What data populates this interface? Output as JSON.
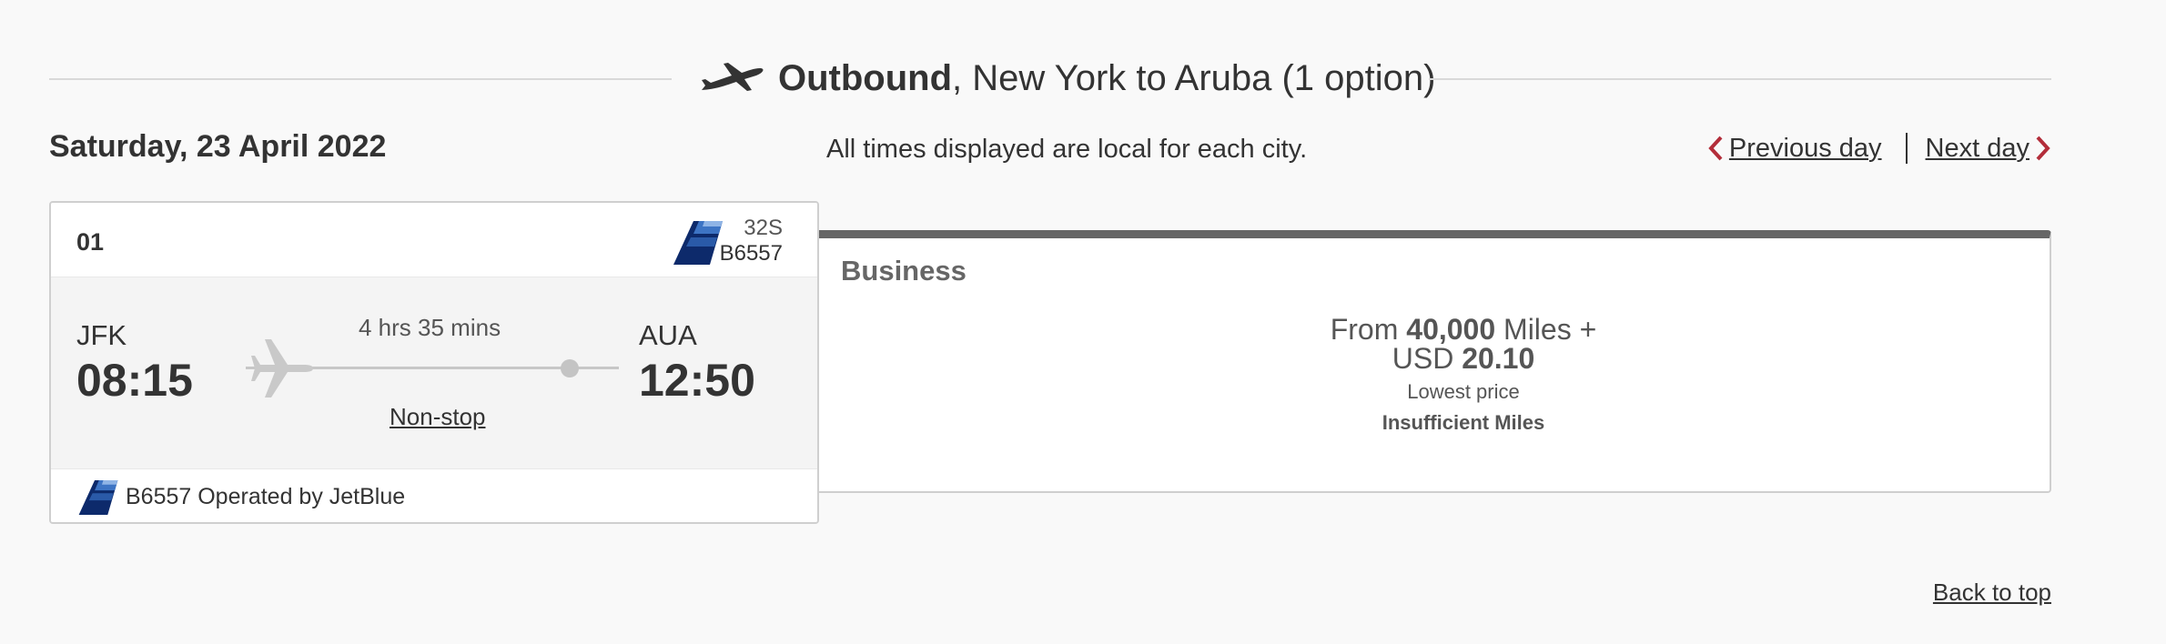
{
  "header": {
    "direction": "Outbound",
    "route": ", New York to Aruba (1 option)"
  },
  "date": "Saturday, 23 April 2022",
  "time_note": "All times displayed are local for each city.",
  "day_nav": {
    "previous": "Previous day",
    "next": "Next day"
  },
  "flight": {
    "option_number": "01",
    "aircraft_type": "32S",
    "flight_number": "B6557",
    "departure": {
      "code": "JFK",
      "time": "08:15"
    },
    "arrival": {
      "code": "AUA",
      "time": "12:50"
    },
    "duration": "4 hrs 35 mins",
    "stops": "Non-stop",
    "operated_by": "B6557 Operated by JetBlue"
  },
  "fare": {
    "cabin": "Business",
    "price_from": "From",
    "miles": "40,000",
    "miles_label": "Miles +",
    "currency": "USD",
    "amount": "20.10",
    "lowest_label": "Lowest price",
    "status": "Insufficient Miles"
  },
  "back_to_top": "Back to top",
  "colors": {
    "accent_red": "#b32d3a",
    "fare_bar": "#666666",
    "jetblue_navy": "#0d2a6b",
    "jetblue_blue": "#3d74c4"
  },
  "icons": [
    "plane-icon",
    "chevron-left-icon",
    "chevron-right-icon",
    "jetblue-tail-icon",
    "plane-track-icon"
  ]
}
